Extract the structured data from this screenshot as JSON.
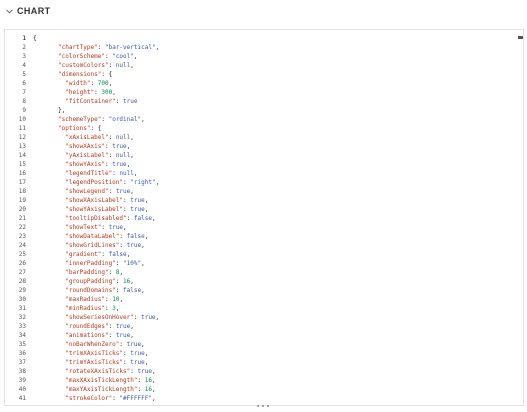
{
  "section": {
    "title": "CHART",
    "expand_icon": "chevron-down-icon"
  },
  "editor": {
    "language": "json",
    "lines": [
      [
        {
          "t": "p",
          "v": "{"
        }
      ],
      [
        {
          "t": "k",
          "v": "\"chartType\""
        },
        {
          "t": "p",
          "v": ": "
        },
        {
          "t": "s",
          "v": "\"bar-vertical\""
        },
        {
          "t": "p",
          "v": ","
        }
      ],
      [
        {
          "t": "k",
          "v": "\"colorScheme\""
        },
        {
          "t": "p",
          "v": ": "
        },
        {
          "t": "s",
          "v": "\"cool\""
        },
        {
          "t": "p",
          "v": ","
        }
      ],
      [
        {
          "t": "k",
          "v": "\"customColors\""
        },
        {
          "t": "p",
          "v": ": "
        },
        {
          "t": "l",
          "v": "null"
        },
        {
          "t": "p",
          "v": ","
        }
      ],
      [
        {
          "t": "k",
          "v": "\"dimensions\""
        },
        {
          "t": "p",
          "v": ": {"
        }
      ],
      [
        {
          "t": "k",
          "v": "  \"width\""
        },
        {
          "t": "p",
          "v": ": "
        },
        {
          "t": "n",
          "v": "700"
        },
        {
          "t": "p",
          "v": ","
        }
      ],
      [
        {
          "t": "k",
          "v": "  \"height\""
        },
        {
          "t": "p",
          "v": ": "
        },
        {
          "t": "n",
          "v": "300"
        },
        {
          "t": "p",
          "v": ","
        }
      ],
      [
        {
          "t": "k",
          "v": "  \"fitContainer\""
        },
        {
          "t": "p",
          "v": ": "
        },
        {
          "t": "l",
          "v": "true"
        }
      ],
      [
        {
          "t": "p",
          "v": "},"
        }
      ],
      [
        {
          "t": "k",
          "v": "\"schemeType\""
        },
        {
          "t": "p",
          "v": ": "
        },
        {
          "t": "s",
          "v": "\"ordinal\""
        },
        {
          "t": "p",
          "v": ","
        }
      ],
      [
        {
          "t": "k",
          "v": "\"options\""
        },
        {
          "t": "p",
          "v": ": {"
        }
      ],
      [
        {
          "t": "k",
          "v": "  \"xAxisLabel\""
        },
        {
          "t": "p",
          "v": ": "
        },
        {
          "t": "l",
          "v": "null"
        },
        {
          "t": "p",
          "v": ","
        }
      ],
      [
        {
          "t": "k",
          "v": "  \"showXAxis\""
        },
        {
          "t": "p",
          "v": ": "
        },
        {
          "t": "l",
          "v": "true"
        },
        {
          "t": "p",
          "v": ","
        }
      ],
      [
        {
          "t": "k",
          "v": "  \"yAxisLabel\""
        },
        {
          "t": "p",
          "v": ": "
        },
        {
          "t": "l",
          "v": "null"
        },
        {
          "t": "p",
          "v": ","
        }
      ],
      [
        {
          "t": "k",
          "v": "  \"showYAxis\""
        },
        {
          "t": "p",
          "v": ": "
        },
        {
          "t": "l",
          "v": "true"
        },
        {
          "t": "p",
          "v": ","
        }
      ],
      [
        {
          "t": "k",
          "v": "  \"legendTitle\""
        },
        {
          "t": "p",
          "v": ": "
        },
        {
          "t": "l",
          "v": "null"
        },
        {
          "t": "p",
          "v": ","
        }
      ],
      [
        {
          "t": "k",
          "v": "  \"legendPosition\""
        },
        {
          "t": "p",
          "v": ": "
        },
        {
          "t": "s",
          "v": "\"right\""
        },
        {
          "t": "p",
          "v": ","
        }
      ],
      [
        {
          "t": "k",
          "v": "  \"showLegend\""
        },
        {
          "t": "p",
          "v": ": "
        },
        {
          "t": "l",
          "v": "true"
        },
        {
          "t": "p",
          "v": ","
        }
      ],
      [
        {
          "t": "k",
          "v": "  \"showXAxisLabel\""
        },
        {
          "t": "p",
          "v": ": "
        },
        {
          "t": "l",
          "v": "true"
        },
        {
          "t": "p",
          "v": ","
        }
      ],
      [
        {
          "t": "k",
          "v": "  \"showYAxisLabel\""
        },
        {
          "t": "p",
          "v": ": "
        },
        {
          "t": "l",
          "v": "true"
        },
        {
          "t": "p",
          "v": ","
        }
      ],
      [
        {
          "t": "k",
          "v": "  \"tooltipDisabled\""
        },
        {
          "t": "p",
          "v": ": "
        },
        {
          "t": "l",
          "v": "false"
        },
        {
          "t": "p",
          "v": ","
        }
      ],
      [
        {
          "t": "k",
          "v": "  \"showText\""
        },
        {
          "t": "p",
          "v": ": "
        },
        {
          "t": "l",
          "v": "true"
        },
        {
          "t": "p",
          "v": ","
        }
      ],
      [
        {
          "t": "k",
          "v": "  \"showDataLabel\""
        },
        {
          "t": "p",
          "v": ": "
        },
        {
          "t": "l",
          "v": "false"
        },
        {
          "t": "p",
          "v": ","
        }
      ],
      [
        {
          "t": "k",
          "v": "  \"showGridLines\""
        },
        {
          "t": "p",
          "v": ": "
        },
        {
          "t": "l",
          "v": "true"
        },
        {
          "t": "p",
          "v": ","
        }
      ],
      [
        {
          "t": "k",
          "v": "  \"gradient\""
        },
        {
          "t": "p",
          "v": ": "
        },
        {
          "t": "l",
          "v": "false"
        },
        {
          "t": "p",
          "v": ","
        }
      ],
      [
        {
          "t": "k",
          "v": "  \"innerPadding\""
        },
        {
          "t": "p",
          "v": ": "
        },
        {
          "t": "s",
          "v": "\"10%\""
        },
        {
          "t": "p",
          "v": ","
        }
      ],
      [
        {
          "t": "k",
          "v": "  \"barPadding\""
        },
        {
          "t": "p",
          "v": ": "
        },
        {
          "t": "n",
          "v": "8"
        },
        {
          "t": "p",
          "v": ","
        }
      ],
      [
        {
          "t": "k",
          "v": "  \"groupPadding\""
        },
        {
          "t": "p",
          "v": ": "
        },
        {
          "t": "n",
          "v": "16"
        },
        {
          "t": "p",
          "v": ","
        }
      ],
      [
        {
          "t": "k",
          "v": "  \"roundDomains\""
        },
        {
          "t": "p",
          "v": ": "
        },
        {
          "t": "l",
          "v": "false"
        },
        {
          "t": "p",
          "v": ","
        }
      ],
      [
        {
          "t": "k",
          "v": "  \"maxRadius\""
        },
        {
          "t": "p",
          "v": ": "
        },
        {
          "t": "n",
          "v": "10"
        },
        {
          "t": "p",
          "v": ","
        }
      ],
      [
        {
          "t": "k",
          "v": "  \"minRadius\""
        },
        {
          "t": "p",
          "v": ": "
        },
        {
          "t": "n",
          "v": "3"
        },
        {
          "t": "p",
          "v": ","
        }
      ],
      [
        {
          "t": "k",
          "v": "  \"showSeriesOnHover\""
        },
        {
          "t": "p",
          "v": ": "
        },
        {
          "t": "l",
          "v": "true"
        },
        {
          "t": "p",
          "v": ","
        }
      ],
      [
        {
          "t": "k",
          "v": "  \"roundEdges\""
        },
        {
          "t": "p",
          "v": ": "
        },
        {
          "t": "l",
          "v": "true"
        },
        {
          "t": "p",
          "v": ","
        }
      ],
      [
        {
          "t": "k",
          "v": "  \"animations\""
        },
        {
          "t": "p",
          "v": ": "
        },
        {
          "t": "l",
          "v": "true"
        },
        {
          "t": "p",
          "v": ","
        }
      ],
      [
        {
          "t": "k",
          "v": "  \"noBarWhenZero\""
        },
        {
          "t": "p",
          "v": ": "
        },
        {
          "t": "l",
          "v": "true"
        },
        {
          "t": "p",
          "v": ","
        }
      ],
      [
        {
          "t": "k",
          "v": "  \"trimXAxisTicks\""
        },
        {
          "t": "p",
          "v": ": "
        },
        {
          "t": "l",
          "v": "true"
        },
        {
          "t": "p",
          "v": ","
        }
      ],
      [
        {
          "t": "k",
          "v": "  \"trimYAxisTicks\""
        },
        {
          "t": "p",
          "v": ": "
        },
        {
          "t": "l",
          "v": "true"
        },
        {
          "t": "p",
          "v": ","
        }
      ],
      [
        {
          "t": "k",
          "v": "  \"rotateXAxisTicks\""
        },
        {
          "t": "p",
          "v": ": "
        },
        {
          "t": "l",
          "v": "true"
        },
        {
          "t": "p",
          "v": ","
        }
      ],
      [
        {
          "t": "k",
          "v": "  \"maxXAxisTickLength\""
        },
        {
          "t": "p",
          "v": ": "
        },
        {
          "t": "n",
          "v": "16"
        },
        {
          "t": "p",
          "v": ","
        }
      ],
      [
        {
          "t": "k",
          "v": "  \"maxYAxisTickLength\""
        },
        {
          "t": "p",
          "v": ": "
        },
        {
          "t": "n",
          "v": "16"
        },
        {
          "t": "p",
          "v": ","
        }
      ],
      [
        {
          "t": "k",
          "v": "  \"strokeColor\""
        },
        {
          "t": "p",
          "v": ": "
        },
        {
          "t": "s",
          "v": "\"#FFFFFF\""
        },
        {
          "t": "p",
          "v": ","
        }
      ]
    ]
  },
  "colors": {
    "key": "#b5391f",
    "string": "#3a58b0",
    "number": "#098658",
    "literal": "#3a58b0",
    "punctuation": "#222222",
    "line_number": "#555555"
  }
}
